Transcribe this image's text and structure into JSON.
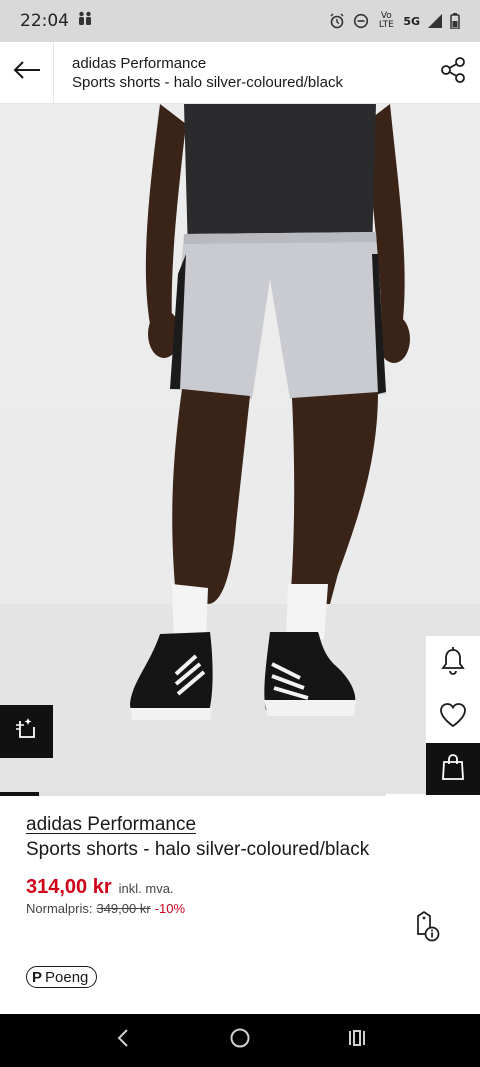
{
  "status_bar": {
    "time": "22:04",
    "volte_label": "Vo LTE",
    "network": "5G"
  },
  "header": {
    "brand": "adidas Performance",
    "product": "Sports shorts - halo silver-coloured/black"
  },
  "product": {
    "brand": "adidas Performance",
    "name": "Sports shorts - halo silver-coloured/black"
  },
  "pricing": {
    "current_price": "314,00 kr",
    "vat_label": "inkl. mva.",
    "normal_label": "Normalpris:",
    "old_price": "349,00 kr",
    "discount": "-10%"
  },
  "points": {
    "label": "Poeng",
    "mark": "P"
  },
  "image_gallery": {
    "progress": 0.1
  },
  "colors": {
    "sale_red": "#d0021b",
    "dark": "#111111"
  },
  "icons": {
    "back": "arrow-left-icon",
    "share": "share-icon",
    "notify": "bell-icon",
    "wishlist": "heart-icon",
    "bag": "shopping-bag-icon",
    "tryon": "virtual-try-on-icon",
    "price_info": "price-tag-info-icon"
  }
}
